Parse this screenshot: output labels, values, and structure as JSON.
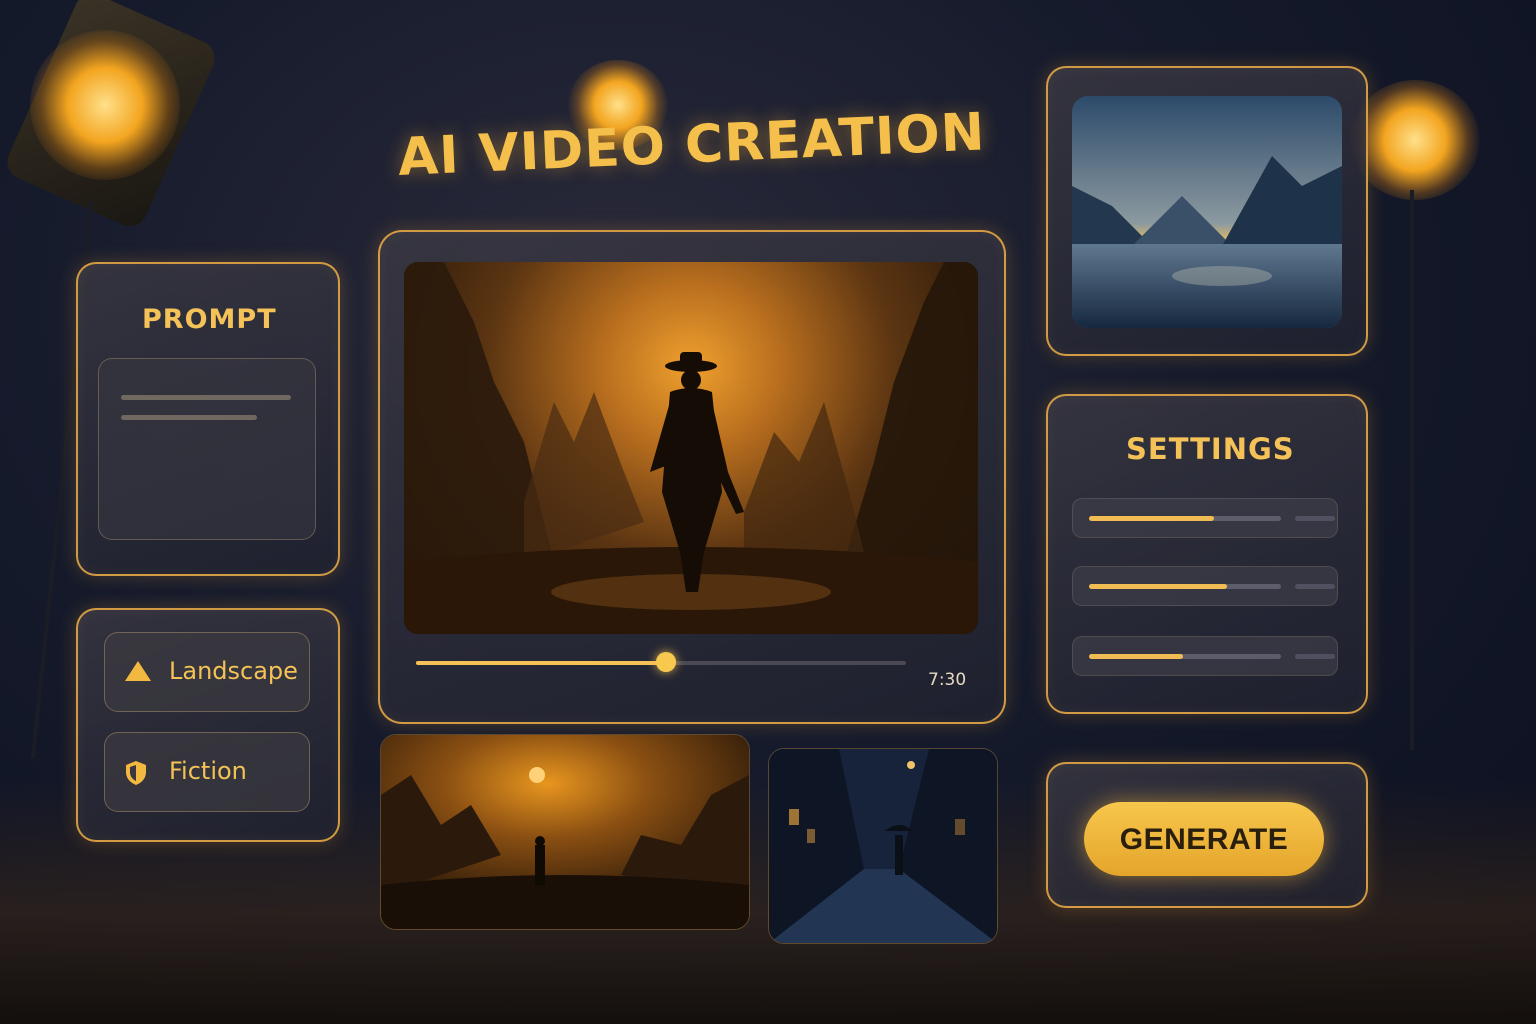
{
  "app": {
    "title": "AI VIDEO CREATION"
  },
  "prompt_panel": {
    "heading": "PROMPT",
    "input_value": ""
  },
  "options": [
    {
      "label": "Landscape",
      "icon": "triangle-icon"
    },
    {
      "label": "Fiction",
      "icon": "shield-icon"
    }
  ],
  "player": {
    "time": "7:30",
    "progress": 0.51
  },
  "settings_panel": {
    "heading": "SETTINGS",
    "sliders": [
      {
        "value": 0.65
      },
      {
        "value": 0.72
      },
      {
        "value": 0.49
      }
    ]
  },
  "actions": {
    "generate_label": "GENERATE"
  },
  "colors": {
    "accent": "#f4c257",
    "panel_border": "#f0af46",
    "background": "#161b2c",
    "button": "#f2b940"
  }
}
